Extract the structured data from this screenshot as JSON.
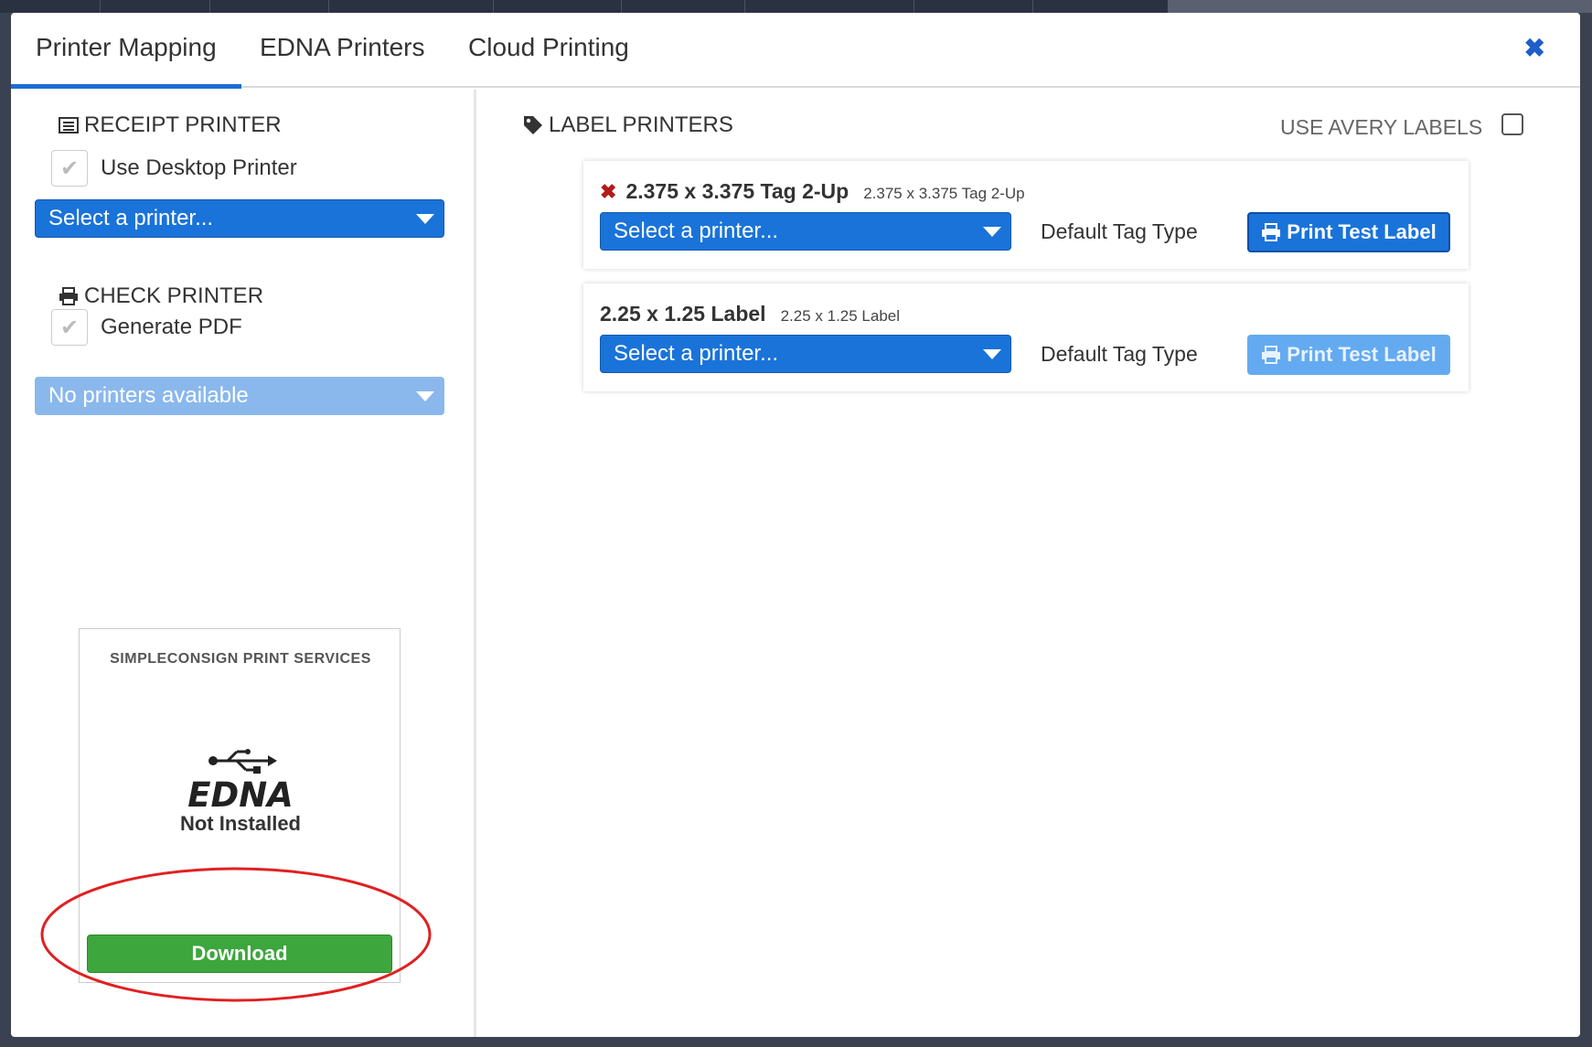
{
  "tabs": [
    {
      "label": "Printer Mapping",
      "active": true
    },
    {
      "label": "EDNA Printers",
      "active": false
    },
    {
      "label": "Cloud Printing",
      "active": false
    }
  ],
  "close_icon": "close-icon",
  "receipt": {
    "title": "RECEIPT PRINTER",
    "checkbox_label": "Use Desktop Printer",
    "select_value": "Select a printer..."
  },
  "check": {
    "title": "CHECK PRINTER",
    "checkbox_label": "Generate PDF",
    "select_value": "No printers available"
  },
  "services": {
    "title": "SIMPLECONSIGN PRINT SERVICES",
    "logo_text": "EDNA",
    "status": "Not Installed",
    "download_label": "Download"
  },
  "label_printers": {
    "title": "LABEL PRINTERS",
    "avery_label": "USE AVERY LABELS",
    "cards": [
      {
        "title": "2.375 x 3.375 Tag 2-Up",
        "subtitle": "2.375 x 3.375 Tag 2-Up",
        "select_value": "Select a printer...",
        "default_tag": "Default Tag Type",
        "button_label": "Print Test Label"
      },
      {
        "title": "2.25 x 1.25 Label",
        "subtitle": "2.25 x 1.25 Label",
        "select_value": "Select a printer...",
        "default_tag": "Default Tag Type",
        "button_label": "Print Test Label"
      }
    ]
  },
  "colors": {
    "accent": "#1a73d9",
    "download_green": "#3da63d",
    "error_red": "#b41a1a",
    "highlight_red": "#e02020"
  }
}
